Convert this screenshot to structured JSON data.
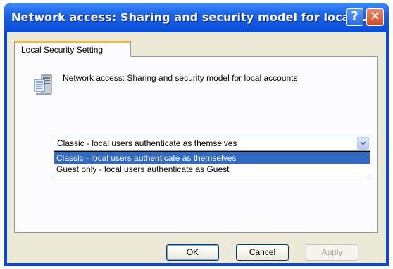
{
  "window": {
    "title": "Network access: Sharing and security model for local..."
  },
  "titlebar": {
    "help_glyph": "?",
    "close_glyph": "✕"
  },
  "tabs": [
    {
      "label": "Local Security Setting"
    }
  ],
  "policy": {
    "icon": "policy-server-icon",
    "name": "Network access: Sharing and security model for local accounts"
  },
  "select": {
    "value": "Classic - local users authenticate as themselves",
    "options": [
      "Classic - local users authenticate as themselves",
      "Guest only - local users authenticate as Guest"
    ],
    "highlighted_index": 0
  },
  "buttons": {
    "ok": "OK",
    "cancel": "Cancel",
    "apply": "Apply"
  },
  "colors": {
    "titlebar": "#0b4dd8",
    "highlight": "#316ac5",
    "tab_accent": "#f4b84a",
    "face": "#ece9d8"
  }
}
